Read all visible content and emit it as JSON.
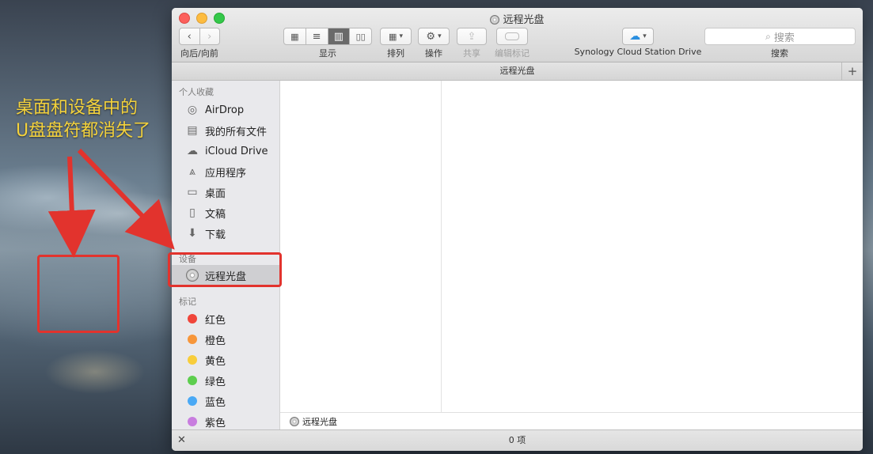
{
  "annotation": {
    "line1": "桌面和设备中的",
    "line2": "U盘盘符都消失了"
  },
  "window": {
    "title": "远程光盘"
  },
  "toolbar": {
    "back_forward_label": "向后/向前",
    "view_label": "显示",
    "arrange_label": "排列",
    "action_label": "操作",
    "share_label": "共享",
    "edit_tags_label": "编辑标记",
    "cloud_label": "Synology Cloud Station Drive",
    "search_label": "搜索",
    "search_placeholder": "搜索"
  },
  "pathbar": {
    "title": "远程光盘"
  },
  "sidebar": {
    "favorites_header": "个人收藏",
    "favorites": [
      {
        "label": "AirDrop",
        "icon": "airdrop-icon"
      },
      {
        "label": "我的所有文件",
        "icon": "all-files-icon"
      },
      {
        "label": "iCloud Drive",
        "icon": "cloud-icon"
      },
      {
        "label": "应用程序",
        "icon": "applications-icon"
      },
      {
        "label": "桌面",
        "icon": "desktop-icon"
      },
      {
        "label": "文稿",
        "icon": "documents-icon"
      },
      {
        "label": "下载",
        "icon": "download-icon"
      }
    ],
    "devices_header": "设备",
    "devices": [
      {
        "label": "远程光盘",
        "icon": "disc-icon",
        "selected": true
      }
    ],
    "tags_header": "标记",
    "tags": [
      {
        "label": "红色",
        "color": "#f0453a"
      },
      {
        "label": "橙色",
        "color": "#f7963a"
      },
      {
        "label": "黄色",
        "color": "#f8cd3b"
      },
      {
        "label": "绿色",
        "color": "#5dce4e"
      },
      {
        "label": "蓝色",
        "color": "#4aa9f5"
      },
      {
        "label": "紫色",
        "color": "#c87ddf"
      }
    ]
  },
  "footer": {
    "path_item": "远程光盘",
    "status": "0 项"
  }
}
